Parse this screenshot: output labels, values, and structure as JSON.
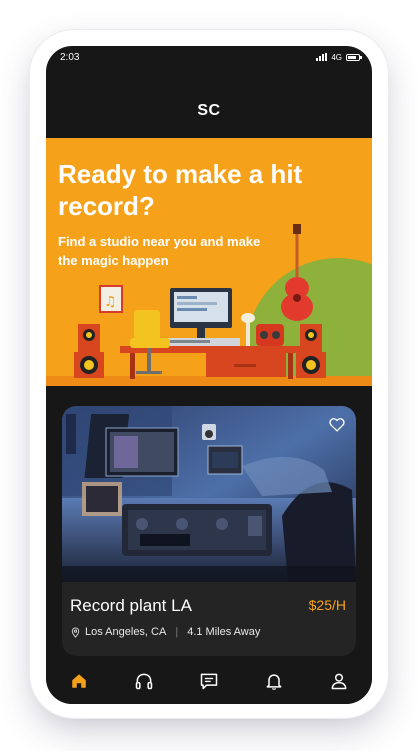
{
  "status_bar": {
    "time": "2:03",
    "network": "4G"
  },
  "header": {
    "title": "SC"
  },
  "hero": {
    "title": "Ready to make a hit record?",
    "subtitle": "Find a studio near you and make the magic happen"
  },
  "studio_card": {
    "title": "Record plant LA",
    "price": "$25/H",
    "location": "Los Angeles, CA",
    "distance": "4.1 Miles Away",
    "favorite_icon": "heart-outline-icon"
  },
  "bottom_nav": {
    "items": [
      {
        "name": "home",
        "icon": "home-icon",
        "active": true
      },
      {
        "name": "studios",
        "icon": "headphones-icon",
        "active": false
      },
      {
        "name": "messages",
        "icon": "chat-icon",
        "active": false
      },
      {
        "name": "notifications",
        "icon": "bell-icon",
        "active": false
      },
      {
        "name": "profile",
        "icon": "user-icon",
        "active": false
      }
    ]
  },
  "colors": {
    "accent": "#f6a11a",
    "background": "#171717",
    "card": "#242424",
    "hill": "#8db13b"
  }
}
